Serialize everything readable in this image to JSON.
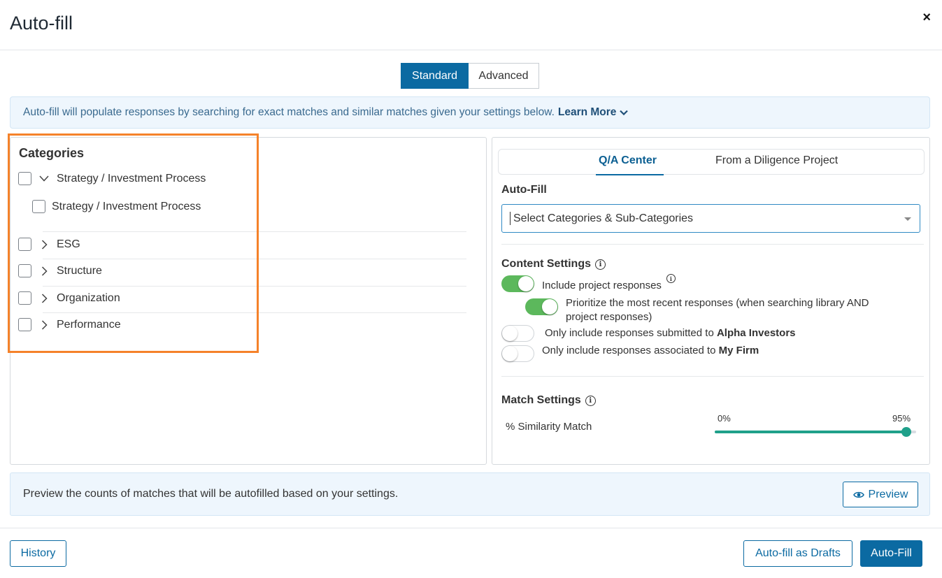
{
  "header": {
    "title": "Auto-fill",
    "close_label": "×"
  },
  "mode_toggle": {
    "standard": "Standard",
    "advanced": "Advanced",
    "selected": "Standard"
  },
  "banner": {
    "text": "Auto-fill will populate responses by searching for exact matches and similar matches given your settings below.",
    "learn_more": "Learn More"
  },
  "categories": {
    "title": "Categories",
    "items": [
      {
        "label": "Strategy / Investment Process",
        "expanded": true,
        "checked": false
      },
      {
        "label": "Strategy / Investment Process",
        "is_child": true,
        "checked": false
      },
      {
        "label": "ESG",
        "expanded": false,
        "checked": false
      },
      {
        "label": "Structure",
        "expanded": false,
        "checked": false
      },
      {
        "label": "Organization",
        "expanded": false,
        "checked": false
      },
      {
        "label": "Performance",
        "expanded": false,
        "checked": false
      }
    ]
  },
  "right_panel": {
    "tabs": [
      {
        "label": "Q/A Center",
        "active": true
      },
      {
        "label": "From a Diligence Project",
        "active": false
      }
    ],
    "autofill_label": "Auto-Fill",
    "select_placeholder": "Select Categories & Sub-Categories",
    "content_settings": {
      "title": "Content Settings",
      "include_project": {
        "label": "Include project responses",
        "on": true
      },
      "prioritize_recent": {
        "label_line1": "Prioritize the most recent responses (when searching library AND",
        "label_line2": "project responses)",
        "on": true
      },
      "only_submitted": {
        "label_prefix": "Only include responses submitted to ",
        "label_bold": "Alpha Investors",
        "on": false
      },
      "only_associated": {
        "label_prefix": "Only include responses associated to ",
        "label_bold": "My Firm",
        "on": false
      }
    },
    "match_settings": {
      "title": "Match Settings",
      "similarity_label": "% Similarity Match",
      "min_label": "0%",
      "max_label": "95%",
      "value_percent": 95
    }
  },
  "preview": {
    "text": "Preview the counts of matches that will be autofilled based on your settings.",
    "button": "Preview"
  },
  "footer": {
    "history": "History",
    "autofill_drafts": "Auto-fill as Drafts",
    "autofill": "Auto-Fill"
  },
  "colors": {
    "primary": "#0b6aa2",
    "highlight": "#f5822a",
    "toggle_on": "#5cb85c",
    "slider": "#1fa08a"
  }
}
